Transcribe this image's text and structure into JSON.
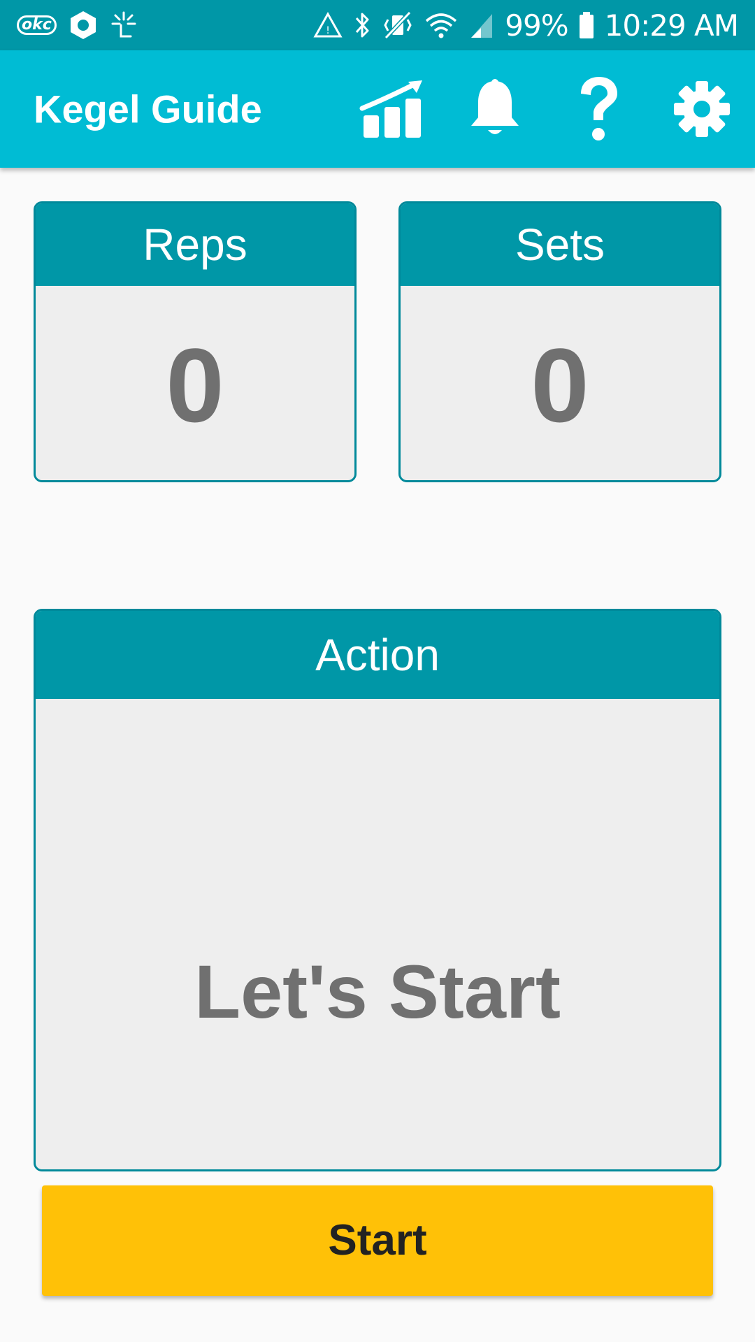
{
  "status_bar": {
    "left_icons": [
      "okc-icon",
      "hexagon-app-icon",
      "sparkle-icon"
    ],
    "right_icons": [
      "recycle-alert-icon",
      "bluetooth-icon",
      "vibrate-mute-icon",
      "wifi-icon",
      "signal-icon",
      "battery-icon"
    ],
    "okc_label": "okc",
    "battery_percent": "99%",
    "time": "10:29 AM"
  },
  "app_bar": {
    "title": "Kegel Guide",
    "actions": [
      "stats-chart-icon",
      "notification-bell-icon",
      "help-question-icon",
      "settings-gear-icon"
    ]
  },
  "reps": {
    "label": "Reps",
    "value": "0"
  },
  "sets": {
    "label": "Sets",
    "value": "0"
  },
  "action": {
    "label": "Action",
    "value": "Let's Start"
  },
  "start_button": {
    "label": "Start"
  },
  "colors": {
    "status_bar": "#0097a7",
    "app_bar": "#00bcd4",
    "card_header": "#0097a7",
    "card_body": "#eeeeee",
    "value_text": "#707070",
    "start_button": "#ffc107"
  }
}
